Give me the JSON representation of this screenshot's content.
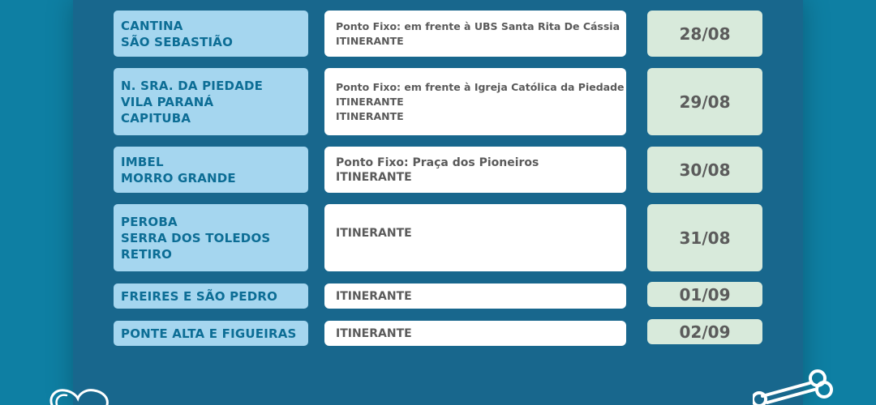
{
  "rows": [
    {
      "locations": [
        "CANTINA",
        "SÃO SEBASTIÃO"
      ],
      "details": [
        "Ponto Fixo: em frente à UBS Santa Rita De Cássia",
        "ITINERANTE"
      ],
      "date": "28/08"
    },
    {
      "locations": [
        "N. SRA. DA PIEDADE",
        "VILA PARANÁ",
        "CAPITUBA"
      ],
      "details": [
        "Ponto Fixo: em frente à Igreja Católica da Piedade",
        "ITINERANTE",
        "ITINERANTE"
      ],
      "date": "29/08"
    },
    {
      "locations": [
        "IMBEL",
        "MORRO GRANDE"
      ],
      "details": [
        "Ponto Fixo: Praça dos Pioneiros",
        "ITINERANTE"
      ],
      "date": "30/08"
    },
    {
      "locations": [
        "PEROBA",
        "SERRA DOS TOLEDOS",
        "RETIRO"
      ],
      "details": [
        "ITINERANTE"
      ],
      "date": "31/08"
    },
    {
      "locations": [
        "FREIRES E SÃO PEDRO"
      ],
      "details": [
        "ITINERANTE"
      ],
      "date": "01/09"
    },
    {
      "locations": [
        "PONTE ALTA E FIGUEIRAS"
      ],
      "details": [
        "ITINERANTE"
      ],
      "date": "02/09"
    }
  ],
  "decorations": {
    "left_icon": "heart-outline-icon",
    "right_icon": "bone-outline-icon"
  },
  "colors": {
    "background": "#0e7fa3",
    "panel": "#18678d",
    "location_box": "#a5d6ef",
    "location_text": "#0c6d95",
    "detail_box": "#ffffff",
    "detail_text": "#5a5a5a",
    "date_box": "#d8eadb",
    "date_text": "#5b5b5b"
  }
}
